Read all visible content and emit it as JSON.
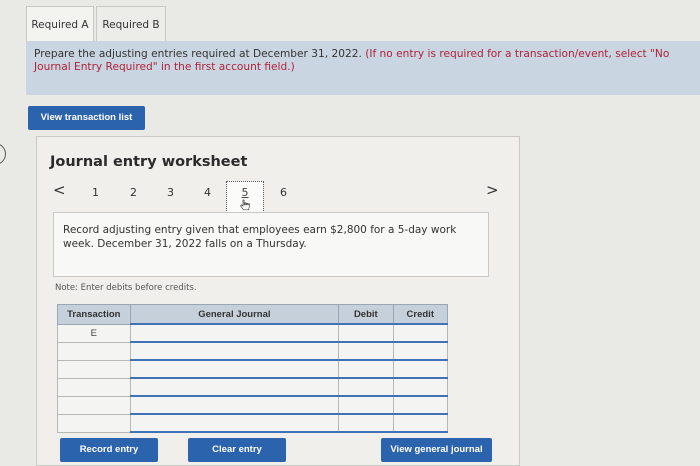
{
  "tabs": [
    {
      "label": "Required A"
    },
    {
      "label": "Required B"
    }
  ],
  "instructions": {
    "text": "Prepare the adjusting entries required at December 31, 2022.",
    "note_red": "(If no entry is required for a transaction/event, select \"No Journal Entry Required\" in the first account field.)"
  },
  "buttons": {
    "view_transactions": "View transaction list",
    "record_entry": "Record entry",
    "clear_entry": "Clear entry",
    "view_general_journal": "View general journal"
  },
  "worksheet": {
    "title": "Journal entry worksheet",
    "pages": [
      "1",
      "2",
      "3",
      "4",
      "5",
      "6"
    ],
    "current_page": "5",
    "prev_glyph": "<",
    "next_glyph": ">",
    "record_text": "Record adjusting entry given that employees earn $2,800 for a 5-day work week. December 31, 2022 falls on a Thursday.",
    "note": "Note: Enter debits before credits."
  },
  "table": {
    "headers": {
      "transaction": "Transaction",
      "general_journal": "General Journal",
      "debit": "Debit",
      "credit": "Credit"
    },
    "rows": [
      {
        "transaction": "E",
        "account": "",
        "debit": "",
        "credit": ""
      },
      {
        "transaction": "",
        "account": "",
        "debit": "",
        "credit": ""
      },
      {
        "transaction": "",
        "account": "",
        "debit": "",
        "credit": ""
      },
      {
        "transaction": "",
        "account": "",
        "debit": "",
        "credit": ""
      },
      {
        "transaction": "",
        "account": "",
        "debit": "",
        "credit": ""
      },
      {
        "transaction": "",
        "account": "",
        "debit": "",
        "credit": ""
      }
    ]
  },
  "colors": {
    "accent": "#2c63ad",
    "instruction_bg": "#c9d6e1",
    "warning_text": "#b0223b"
  }
}
